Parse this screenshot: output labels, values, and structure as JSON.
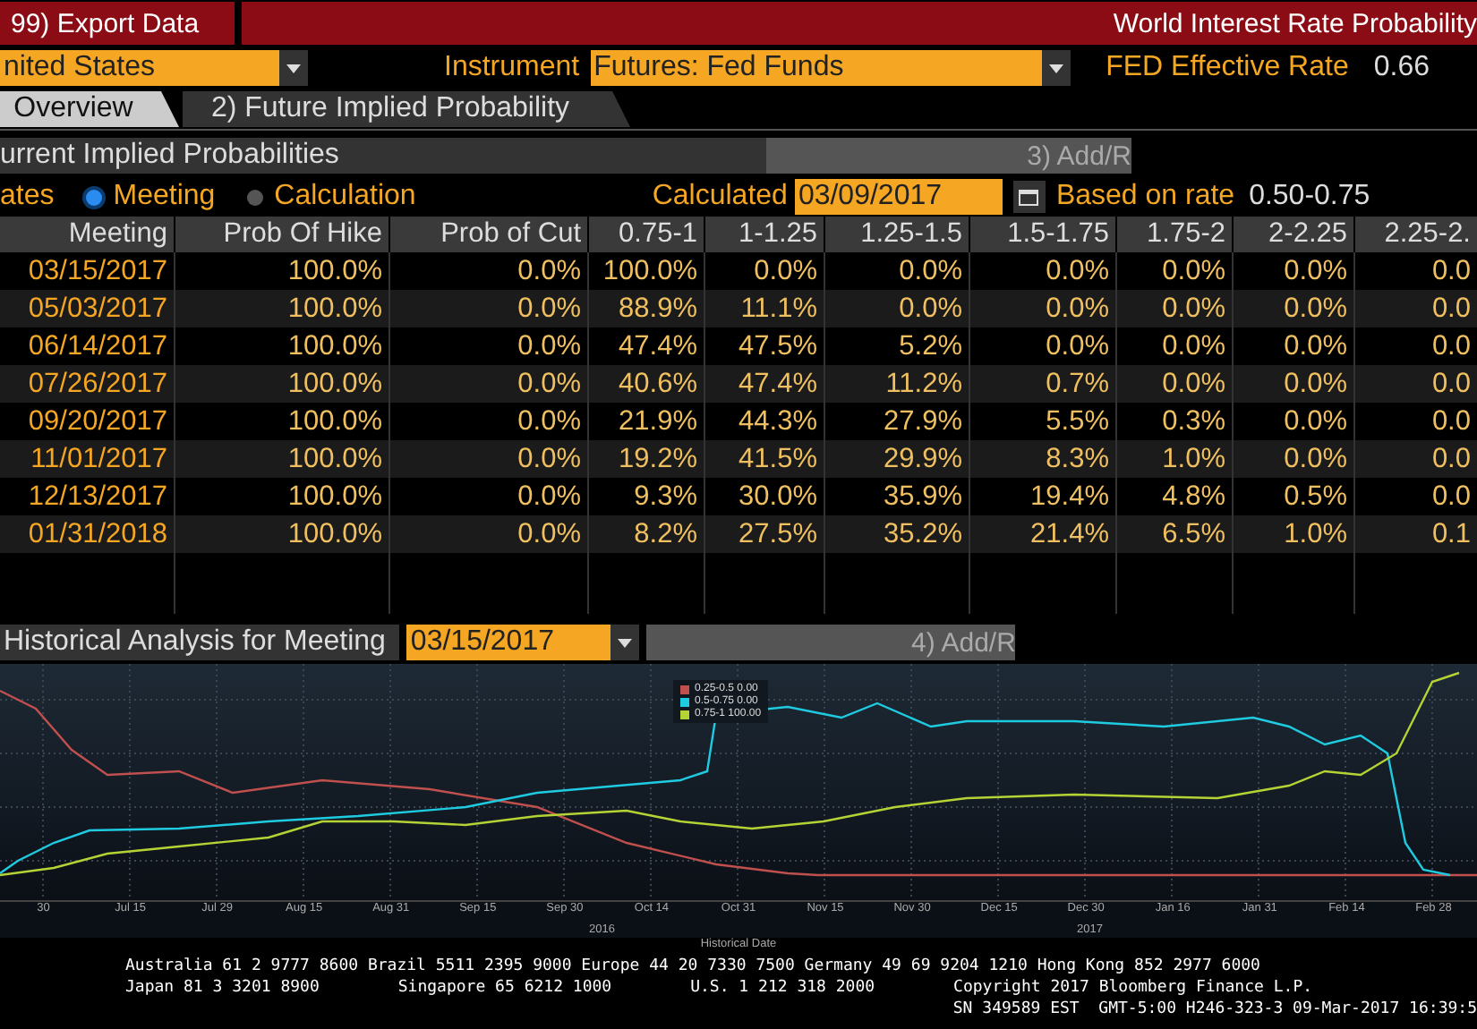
{
  "title_bar": {
    "export_button": "99) Export Data",
    "title": "World Interest Rate Probability"
  },
  "selectors": {
    "region": "nited States",
    "instrument_label": "Instrument",
    "instrument": "Futures: Fed Funds",
    "effective_label": "FED Effective Rate",
    "effective_value": "0.66"
  },
  "tabs": [
    {
      "label": "Overview",
      "selected": true
    },
    {
      "label": "2) Future Implied Probability",
      "selected": false
    }
  ],
  "section": {
    "title": "urrent Implied Probabilities",
    "action": "3) Add/R"
  },
  "options": {
    "lead": "ates",
    "radios": [
      {
        "label": "Meeting",
        "selected": true
      },
      {
        "label": "Calculation",
        "selected": false
      }
    ],
    "calculated_label": "Calculated",
    "calculated_date": "03/09/2017",
    "based_label": "Based on rate",
    "based_value": "0.50-0.75"
  },
  "table": {
    "columns": [
      "Meeting",
      "Prob Of Hike",
      "Prob of Cut",
      "0.75-1",
      "1-1.25",
      "1.25-1.5",
      "1.5-1.75",
      "1.75-2",
      "2-2.25",
      "2.25-2."
    ],
    "rows": [
      [
        "03/15/2017",
        "100.0%",
        "0.0%",
        "100.0%",
        "0.0%",
        "0.0%",
        "0.0%",
        "0.0%",
        "0.0%",
        "0.0"
      ],
      [
        "05/03/2017",
        "100.0%",
        "0.0%",
        "88.9%",
        "11.1%",
        "0.0%",
        "0.0%",
        "0.0%",
        "0.0%",
        "0.0"
      ],
      [
        "06/14/2017",
        "100.0%",
        "0.0%",
        "47.4%",
        "47.5%",
        "5.2%",
        "0.0%",
        "0.0%",
        "0.0%",
        "0.0"
      ],
      [
        "07/26/2017",
        "100.0%",
        "0.0%",
        "40.6%",
        "47.4%",
        "11.2%",
        "0.7%",
        "0.0%",
        "0.0%",
        "0.0"
      ],
      [
        "09/20/2017",
        "100.0%",
        "0.0%",
        "21.9%",
        "44.3%",
        "27.9%",
        "5.5%",
        "0.3%",
        "0.0%",
        "0.0"
      ],
      [
        "11/01/2017",
        "100.0%",
        "0.0%",
        "19.2%",
        "41.5%",
        "29.9%",
        "8.3%",
        "1.0%",
        "0.0%",
        "0.0"
      ],
      [
        "12/13/2017",
        "100.0%",
        "0.0%",
        "9.3%",
        "30.0%",
        "35.9%",
        "19.4%",
        "4.8%",
        "0.5%",
        "0.0"
      ],
      [
        "01/31/2018",
        "100.0%",
        "0.0%",
        "8.2%",
        "27.5%",
        "35.2%",
        "21.4%",
        "6.5%",
        "1.0%",
        "0.1"
      ]
    ]
  },
  "history": {
    "title": "Historical Analysis for Meeting",
    "meeting": "03/15/2017",
    "action": "4) Add/R",
    "legend": [
      {
        "label": "0.25-0.5 0.00",
        "color": "#c0504d"
      },
      {
        "label": "0.5-0.75 0.00",
        "color": "#1ecbe1"
      },
      {
        "label": "0.75-1  100.00",
        "color": "#b5d334"
      }
    ],
    "x_labels": [
      "30",
      "Jul 15",
      "Jul 29",
      "Aug 15",
      "Aug 31",
      "Sep 15",
      "Sep 30",
      "Oct 14",
      "Oct 31",
      "Nov 15",
      "Nov 30",
      "Dec 15",
      "Dec 30",
      "Jan 16",
      "Jan 31",
      "Feb 14",
      "Feb 28"
    ],
    "years": [
      "2016",
      "2017"
    ],
    "x_title": "Historical Date"
  },
  "footer": {
    "line1": "Australia 61 2 9777 8600 Brazil 5511 2395 9000 Europe 44 20 7330 7500 Germany 49 69 9204 1210 Hong Kong 852 2977 6000",
    "line2": [
      "Japan 81 3 3201 8900",
      "Singapore 65 6212 1000",
      "U.S. 1 212 318 2000",
      "Copyright 2017 Bloomberg Finance L.P."
    ],
    "line3": "SN 349589 EST  GMT-5:00 H246-323-3 09-Mar-2017 16:39:5"
  }
}
